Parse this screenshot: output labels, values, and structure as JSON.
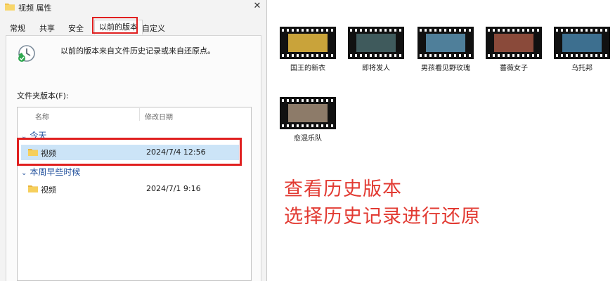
{
  "dialog": {
    "title": "视频 属性",
    "close": "✕",
    "tabs": [
      "常规",
      "共享",
      "安全",
      "以前的版本",
      "自定义"
    ],
    "info_text": "以前的版本来自文件历史记录或来自还原点。",
    "versions_label": "文件夹版本(F):",
    "columns": {
      "name": "名称",
      "date": "修改日期"
    },
    "groups": [
      {
        "label": "今天",
        "items": [
          {
            "name": "视频",
            "date": "2024/7/4 12:56"
          }
        ]
      },
      {
        "label": "本周早些时候",
        "items": [
          {
            "name": "视频",
            "date": "2024/7/1 9:16"
          }
        ]
      }
    ]
  },
  "videos": [
    {
      "label": "国王的新衣",
      "color": "#c9a33a"
    },
    {
      "label": "即将发人",
      "color": "#3f5a5c"
    },
    {
      "label": "男孩看见野玫瑰",
      "color": "#4f7f9a"
    },
    {
      "label": "薔薇女子",
      "color": "#8a4a3a"
    },
    {
      "label": "乌托邦",
      "color": "#3d6f8f"
    },
    {
      "label": "愈混乐队",
      "color": "#8d7b69"
    }
  ],
  "captions": {
    "line1": "查看历史版本",
    "line2": "选择历史记录进行还原"
  },
  "colors": {
    "highlight": "#e02020",
    "caption": "#e23a32",
    "selection": "#cce4f7"
  }
}
